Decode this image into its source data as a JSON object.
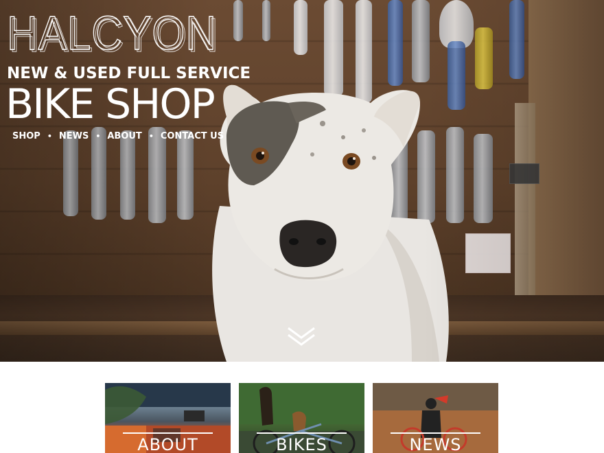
{
  "brand": {
    "logo_text": "HALCYON",
    "tagline": "NEW & USED FULL SERVICE",
    "title": "BIKE SHOP"
  },
  "nav": {
    "items": [
      {
        "label": "SHOP"
      },
      {
        "label": "NEWS"
      },
      {
        "label": "ABOUT"
      },
      {
        "label": "CONTACT US"
      }
    ],
    "separator": "•"
  },
  "hero": {
    "scroll_icon": "double-chevron-down-icon"
  },
  "cards": [
    {
      "label": "ABOUT"
    },
    {
      "label": "BIKES"
    },
    {
      "label": "NEWS"
    }
  ],
  "colors": {
    "text": "#ffffff",
    "background": "#ffffff"
  }
}
